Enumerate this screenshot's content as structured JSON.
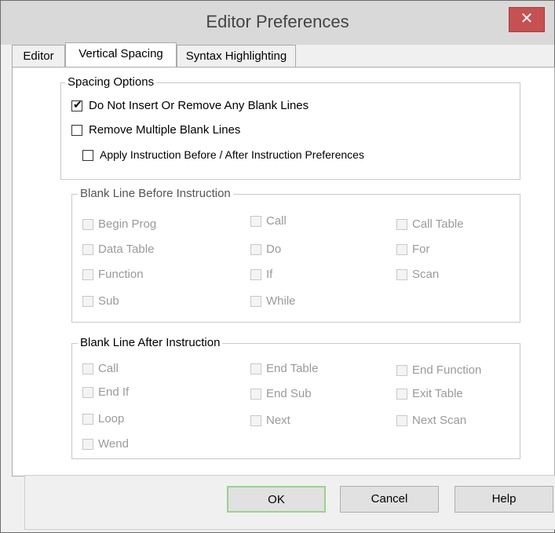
{
  "window": {
    "title": "Editor Preferences",
    "close_glyph": "✕"
  },
  "tabs": [
    {
      "label": "Editor",
      "selected": false
    },
    {
      "label": "Vertical Spacing",
      "selected": true
    },
    {
      "label": "Syntax Highlighting",
      "selected": false
    }
  ],
  "spacing_options": {
    "label": "Spacing Options",
    "do_not_insert": {
      "label": "Do Not Insert Or Remove Any Blank Lines",
      "checked": true
    },
    "remove_multiple": {
      "label": "Remove Multiple Blank Lines",
      "checked": false
    },
    "apply_instruction": {
      "label": "Apply Instruction Before / After Instruction Preferences",
      "checked": false
    }
  },
  "blank_before": {
    "label": "Blank Line Before Instruction",
    "items": [
      {
        "label": "Begin Prog",
        "checked": false
      },
      {
        "label": "Call",
        "checked": false
      },
      {
        "label": "Call Table",
        "checked": false
      },
      {
        "label": "Data Table",
        "checked": false
      },
      {
        "label": "Do",
        "checked": false
      },
      {
        "label": "For",
        "checked": false
      },
      {
        "label": "Function",
        "checked": false
      },
      {
        "label": "If",
        "checked": false
      },
      {
        "label": "Scan",
        "checked": false
      },
      {
        "label": "Sub",
        "checked": false
      },
      {
        "label": "While",
        "checked": false
      }
    ]
  },
  "blank_after": {
    "label": "Blank Line After Instruction",
    "items": [
      {
        "label": "Call",
        "checked": false
      },
      {
        "label": "End Table",
        "checked": false
      },
      {
        "label": "End Function",
        "checked": false
      },
      {
        "label": "End If",
        "checked": false
      },
      {
        "label": "End Sub",
        "checked": false
      },
      {
        "label": "Exit Table",
        "checked": false
      },
      {
        "label": "Loop",
        "checked": false
      },
      {
        "label": "Next",
        "checked": false
      },
      {
        "label": "Next Scan",
        "checked": false
      },
      {
        "label": "Wend",
        "checked": false
      }
    ]
  },
  "buttons": {
    "ok": "OK",
    "cancel": "Cancel",
    "help": "Help"
  }
}
